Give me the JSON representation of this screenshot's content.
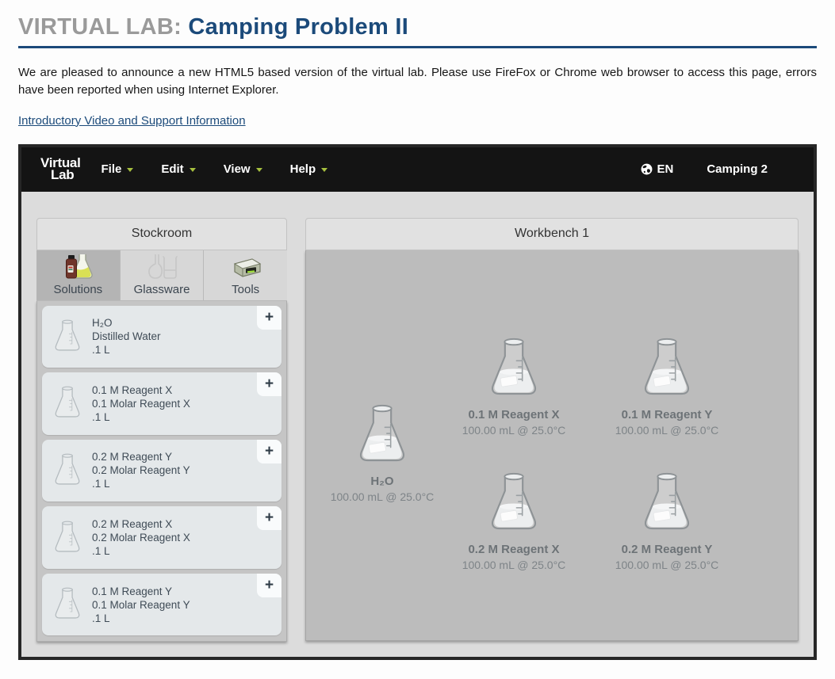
{
  "page": {
    "title_prefix": "VIRTUAL LAB:",
    "title": "Camping Problem II",
    "intro": "We are pleased to announce a new HTML5 based version of the virtual lab. Please use FireFox or Chrome web browser to access this page, errors have been reported when using Internet Explorer.",
    "link_label": "Introductory Video and Support Information"
  },
  "navbar": {
    "logo": {
      "line1": "Virtual",
      "line2": "Lab"
    },
    "menus": [
      {
        "label": "File"
      },
      {
        "label": "Edit"
      },
      {
        "label": "View"
      },
      {
        "label": "Help"
      }
    ],
    "language_label": "EN",
    "app_title": "Camping 2"
  },
  "stockroom": {
    "title": "Stockroom",
    "tabs": [
      {
        "label": "Solutions",
        "icon": "solutions-flask-icon",
        "active": true
      },
      {
        "label": "Glassware",
        "icon": "glassware-icon",
        "active": false
      },
      {
        "label": "Tools",
        "icon": "scale-icon",
        "active": false
      }
    ],
    "items": [
      {
        "name": "H₂O",
        "desc": "Distilled Water",
        "volume": ".1 L",
        "add_label": "+"
      },
      {
        "name": "0.1 M Reagent X",
        "desc": "0.1 Molar Reagent X",
        "volume": ".1 L",
        "add_label": "+"
      },
      {
        "name": "0.2 M Reagent Y",
        "desc": "0.2 Molar Reagent Y",
        "volume": ".1 L",
        "add_label": "+"
      },
      {
        "name": "0.2 M Reagent X",
        "desc": "0.2 Molar Reagent X",
        "volume": ".1 L",
        "add_label": "+"
      },
      {
        "name": "0.1 M Reagent Y",
        "desc": "0.1 Molar Reagent Y",
        "volume": ".1 L",
        "add_label": "+"
      }
    ]
  },
  "workbench": {
    "title": "Workbench 1",
    "flasks": [
      {
        "name": "H₂O",
        "info": "100.00 mL @ 25.0°C"
      },
      {
        "name": "0.1 M Reagent X",
        "info": "100.00 mL @ 25.0°C"
      },
      {
        "name": "0.1 M Reagent Y",
        "info": "100.00 mL @ 25.0°C"
      },
      {
        "name": "0.2 M Reagent X",
        "info": "100.00 mL @ 25.0°C"
      },
      {
        "name": "0.2 M Reagent Y",
        "info": "100.00 mL @ 25.0°C"
      }
    ]
  },
  "colors": {
    "accent_navy": "#1b4a7a",
    "menu_caret_green": "#a6bf3e",
    "navbar_black": "#141414",
    "workbench_gray": "#bcbcbc",
    "card_gray": "#e4e8ea"
  }
}
